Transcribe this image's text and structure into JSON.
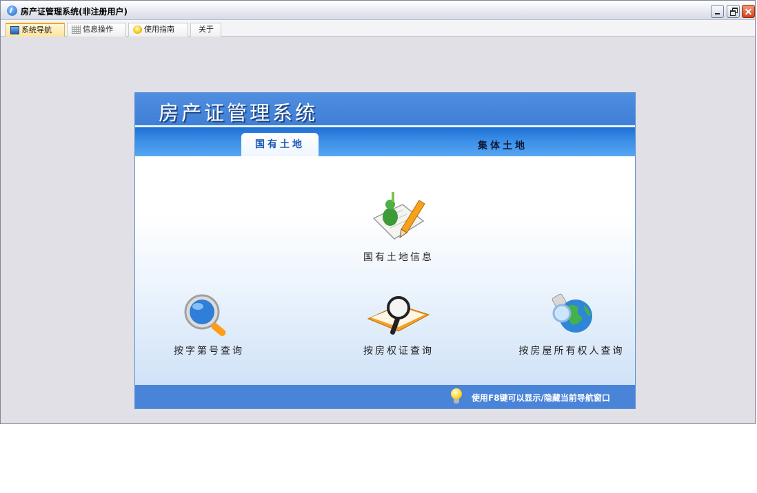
{
  "window": {
    "title": "房产证管理系统(非注册用户)"
  },
  "tabs": [
    {
      "label": "系统导航",
      "icon": "monitor-icon"
    },
    {
      "label": "信息操作",
      "icon": "grid-icon"
    },
    {
      "label": "使用指南",
      "icon": "help-icon"
    },
    {
      "label": "关于"
    }
  ],
  "panel": {
    "title": "房产证管理系统",
    "subtabs": [
      "国有土地",
      "集体土地"
    ],
    "items": [
      {
        "label": "国有土地信息",
        "icon": "land-info-icon"
      },
      {
        "label": "按字第号查询",
        "icon": "magnifier-icon"
      },
      {
        "label": "按房权证查询",
        "icon": "book-search-icon"
      },
      {
        "label": "按房屋所有权人查询",
        "icon": "globe-search-icon"
      }
    ],
    "footer_tip": "使用F8键可以显示/隐藏当前导航窗口"
  },
  "colors": {
    "accent": "#3f7fd6",
    "active_tab": "#ffe49a"
  }
}
